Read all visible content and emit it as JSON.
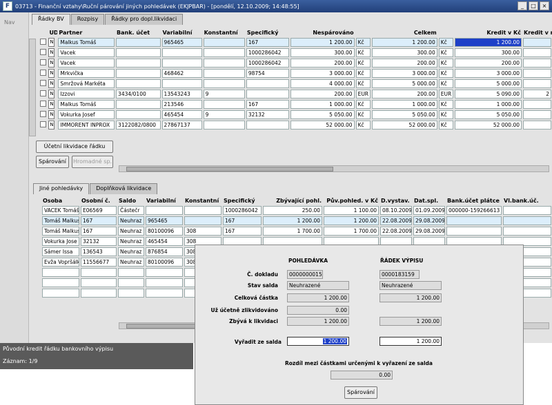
{
  "window": {
    "title": "03713 - Finanční vztahy\\Ruční párování jiných pohledávek (EKJPBAR) - [pondělí, 12.10.2009; 14:48:55]",
    "app_icon": "app-icon",
    "minimize": "_",
    "maximize": "□",
    "close": "×"
  },
  "left": {
    "nav_label": "Nav"
  },
  "top_tabs": [
    "Řádky BV",
    "Rozpisy",
    "Řádky pro dopl.likvidaci"
  ],
  "top_grid": {
    "columns": [
      "UDD",
      "Partner",
      "Bank. účet",
      "Variabilní",
      "Konstantní",
      "Specifický",
      "Nespárováno",
      "",
      "Celkem",
      "",
      "Kredit v Kč",
      "Kredit v měně"
    ],
    "rows": [
      {
        "flag": "N",
        "partner": "Malkus Tomáš",
        "bank": "",
        "var": "965465",
        "konst": "",
        "spec": "167",
        "nesp": "1 200.00",
        "cur1": "Kč",
        "celkem": "1 200.00",
        "cur2": "Kč",
        "kredit": "1 200.00",
        "kredit_m": ""
      },
      {
        "flag": "N",
        "partner": "Vacek",
        "bank": "",
        "var": "",
        "konst": "",
        "spec": "1000286042",
        "nesp": "300.00",
        "cur1": "Kč",
        "celkem": "300.00",
        "cur2": "Kč",
        "kredit": "300.00",
        "kredit_m": ""
      },
      {
        "flag": "N",
        "partner": "Vacek",
        "bank": "",
        "var": "",
        "konst": "",
        "spec": "1000286042",
        "nesp": "200.00",
        "cur1": "Kč",
        "celkem": "200.00",
        "cur2": "Kč",
        "kredit": "200.00",
        "kredit_m": ""
      },
      {
        "flag": "N",
        "partner": "Mrkvička",
        "bank": "",
        "var": "468462",
        "konst": "",
        "spec": "98754",
        "nesp": "3 000.00",
        "cur1": "Kč",
        "celkem": "3 000.00",
        "cur2": "Kč",
        "kredit": "3 000.00",
        "kredit_m": ""
      },
      {
        "flag": "N",
        "partner": "Smržová Markéta",
        "bank": "",
        "var": "",
        "konst": "",
        "spec": "",
        "nesp": "4 000.00",
        "cur1": "Kč",
        "celkem": "5 000.00",
        "cur2": "Kč",
        "kredit": "5 000.00",
        "kredit_m": ""
      },
      {
        "flag": "N",
        "partner": "Izzovi",
        "bank": "3434/0100",
        "var": "13543243",
        "konst": "9",
        "spec": "",
        "nesp": "200.00",
        "cur1": "EUR",
        "celkem": "200.00",
        "cur2": "EUR",
        "kredit": "5 090.00",
        "kredit_m": "2"
      },
      {
        "flag": "N",
        "partner": "Malkus Tomáš",
        "bank": "",
        "var": "213546",
        "konst": "",
        "spec": "167",
        "nesp": "1 000.00",
        "cur1": "Kč",
        "celkem": "1 000.00",
        "cur2": "Kč",
        "kredit": "1 000.00",
        "kredit_m": ""
      },
      {
        "flag": "N",
        "partner": "Vokurka Josef",
        "bank": "",
        "var": "465454",
        "konst": "9",
        "spec": "32132",
        "nesp": "5 050.00",
        "cur1": "Kč",
        "celkem": "5 050.00",
        "cur2": "Kč",
        "kredit": "5 050.00",
        "kredit_m": ""
      },
      {
        "flag": "N",
        "partner": "IMMORENT INPROX",
        "bank": "3122082/0800",
        "var": "27867137",
        "konst": "",
        "spec": "",
        "nesp": "52 000.00",
        "cur1": "Kč",
        "celkem": "52 000.00",
        "cur2": "Kč",
        "kredit": "52 000.00",
        "kredit_m": ""
      }
    ]
  },
  "buttons": {
    "likvidace": "Účetní likvidace řádku",
    "parovani": "Spárování",
    "hromadne": "Hromadné sp."
  },
  "bottom_tabs": [
    "Jiné pohledávky",
    "Doplňková likvidace"
  ],
  "bottom_grid": {
    "columns": [
      "Osoba",
      "Osobní č.",
      "Saldo",
      "Variabilní",
      "Konstantní",
      "Specifický",
      "Zbývající pohl.",
      "Pův.pohled. v Kč",
      "D.vystav.",
      "Dat.spl.",
      "Bank.účet plátce",
      "Vl.bank.úč."
    ],
    "rows": [
      {
        "osoba": "VACEK Tomáš",
        "osc": "E06569",
        "saldo": "Částečr",
        "var": "",
        "konst": "",
        "spec": "1000286042",
        "zbyv": "250.00",
        "puv": "1 100.00",
        "dvyst": "08.10.2009",
        "dspl": "01.09.2009",
        "bank": "000000-159266613",
        "vl": ""
      },
      {
        "osoba": "Tomáš Malkus",
        "osc": "167",
        "saldo": "Neuhraz",
        "var": "965465",
        "konst": "",
        "spec": "167",
        "zbyv": "1 200.00",
        "puv": "1 200.00",
        "dvyst": "22.08.2009",
        "dspl": "29.08.2009",
        "bank": "",
        "vl": ""
      },
      {
        "osoba": "Tomáš Malkus",
        "osc": "167",
        "saldo": "Neuhraz",
        "var": "80100096",
        "konst": "308",
        "spec": "167",
        "zbyv": "1 700.00",
        "puv": "1 700.00",
        "dvyst": "22.08.2009",
        "dspl": "29.08.2009",
        "bank": "",
        "vl": ""
      },
      {
        "osoba": "Vokurka Jose",
        "osc": "32132",
        "saldo": "Neuhraz",
        "var": "465454",
        "konst": "308",
        "spec": "",
        "zbyv": "",
        "puv": "",
        "dvyst": "",
        "dspl": "",
        "bank": "",
        "vl": ""
      },
      {
        "osoba": "Sámer Issa",
        "osc": "136543",
        "saldo": "Neuhraz",
        "var": "876854",
        "konst": "308",
        "spec": "",
        "zbyv": "",
        "puv": "",
        "dvyst": "",
        "dspl": "",
        "bank": "",
        "vl": ""
      },
      {
        "osoba": "Evža Vopršálk",
        "osc": "11556677",
        "saldo": "Neuhraz",
        "var": "80100096",
        "konst": "308",
        "spec": "",
        "zbyv": "",
        "puv": "",
        "dvyst": "",
        "dspl": "",
        "bank": "",
        "vl": ""
      },
      {
        "osoba": "",
        "osc": "",
        "saldo": "",
        "var": "",
        "konst": "",
        "spec": "",
        "zbyv": "",
        "puv": "",
        "dvyst": "",
        "dspl": "",
        "bank": "",
        "vl": ""
      },
      {
        "osoba": "",
        "osc": "",
        "saldo": "",
        "var": "",
        "konst": "",
        "spec": "",
        "zbyv": "",
        "puv": "",
        "dvyst": "",
        "dspl": "",
        "bank": "",
        "vl": ""
      },
      {
        "osoba": "",
        "osc": "",
        "saldo": "",
        "var": "",
        "konst": "",
        "spec": "",
        "zbyv": "",
        "puv": "",
        "dvyst": "",
        "dspl": "",
        "bank": "",
        "vl": ""
      }
    ]
  },
  "status": {
    "line1": "Původní kredit řádku bankovního výpisu",
    "line2": "Záznam: 1/9"
  },
  "dialog": {
    "col1_header": "POHLEDÁVKA",
    "col2_header": "ŘÁDEK VÝPISU",
    "labels": {
      "doklad": "Č. dokladu",
      "stav": "Stav salda",
      "celkova": "Celková částka",
      "zlikvidovano": "Už účetně zlikvidováno",
      "zbyva": "Zbývá k likvidaci",
      "vyradit": "Vyřadit ze salda",
      "rozdil": "Rozdíl mezi částkami určenými k vyřazení ze salda"
    },
    "pohl": {
      "doklad": "0000000015",
      "stav": "Neuhrazené",
      "celkova": "1 200.00",
      "zlikvidovano": "0.00",
      "zbyva": "1 200.00",
      "vyradit": "1 200.00"
    },
    "radek": {
      "doklad": "0000183159",
      "stav": "Neuhrazené",
      "celkova": "1 200.00",
      "zbyva": "1 200.00",
      "vyradit": "1 200.00"
    },
    "rozdil_value": "0.00",
    "button": "Spárování"
  }
}
